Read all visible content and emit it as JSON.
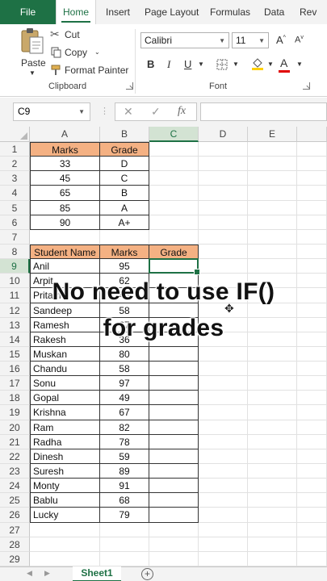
{
  "ribbon_tabs": [
    "File",
    "Home",
    "Insert",
    "Page Layout",
    "Formulas",
    "Data",
    "Rev"
  ],
  "clipboard": {
    "paste": "Paste",
    "cut": "Cut",
    "copy": "Copy",
    "format_painter": "Format Painter",
    "label": "Clipboard"
  },
  "font": {
    "name": "Calibri",
    "size": "11",
    "label": "Font",
    "bold": "B",
    "italic": "I",
    "underline": "U"
  },
  "formula_bar": {
    "name_box": "C9",
    "fx": "fx"
  },
  "columns": [
    "A",
    "B",
    "C",
    "D",
    "E"
  ],
  "rows": [
    "1",
    "2",
    "3",
    "4",
    "5",
    "6",
    "7",
    "8",
    "9",
    "10",
    "11",
    "12",
    "13",
    "14",
    "15",
    "16",
    "17",
    "18",
    "19",
    "20",
    "21",
    "22",
    "23",
    "24",
    "25",
    "26",
    "27",
    "28",
    "29"
  ],
  "grade_table": {
    "headers": [
      "Marks",
      "Grade"
    ],
    "rows": [
      [
        "33",
        "D"
      ],
      [
        "45",
        "C"
      ],
      [
        "65",
        "B"
      ],
      [
        "85",
        "A"
      ],
      [
        "90",
        "A+"
      ]
    ]
  },
  "student_table": {
    "headers": [
      "Student Name",
      "Marks",
      "Grade"
    ],
    "rows": [
      [
        "Anil",
        "95"
      ],
      [
        "Arpit",
        "62"
      ],
      [
        "Pritam",
        "45"
      ],
      [
        "Sandeep",
        "58"
      ],
      [
        "Ramesh",
        "67"
      ],
      [
        "Rakesh",
        "36"
      ],
      [
        "Muskan",
        "80"
      ],
      [
        "Chandu",
        "58"
      ],
      [
        "Sonu",
        "97"
      ],
      [
        "Gopal",
        "49"
      ],
      [
        "Krishna",
        "67"
      ],
      [
        "Ram",
        "82"
      ],
      [
        "Radha",
        "78"
      ],
      [
        "Dinesh",
        "59"
      ],
      [
        "Suresh",
        "89"
      ],
      [
        "Monty",
        "91"
      ],
      [
        "Bablu",
        "68"
      ],
      [
        "Lucky",
        "79"
      ]
    ]
  },
  "overlay": {
    "line1": "No need to use IF()",
    "line2": "for grades"
  },
  "sheet_tab": "Sheet1",
  "colors": {
    "accent": "#1e7145",
    "header_fill": "#f4b183"
  }
}
